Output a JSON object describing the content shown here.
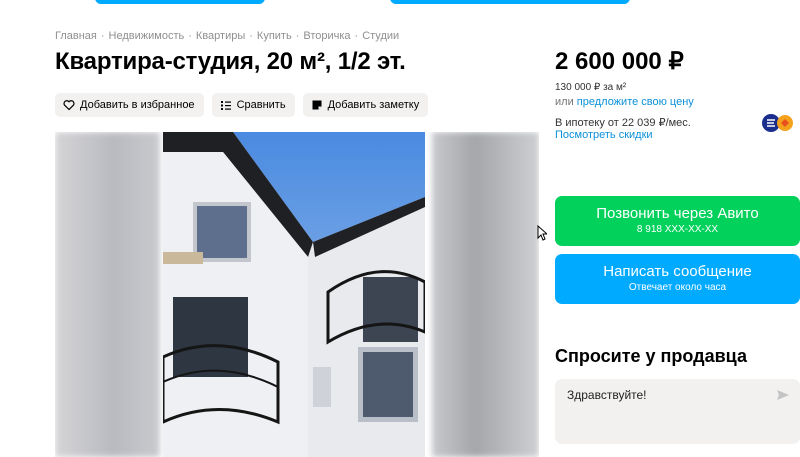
{
  "breadcrumb": [
    "Главная",
    "Недвижимость",
    "Квартиры",
    "Купить",
    "Вторичка",
    "Студии"
  ],
  "listing": {
    "title": "Квартира-студия, 20 м², 1/2 эт."
  },
  "actions": {
    "favorite": "Добавить в избранное",
    "compare": "Сравнить",
    "note": "Добавить заметку"
  },
  "price": {
    "value": "2 600 000 ₽",
    "per_m2": "130 000 ₽ за м²",
    "offer_prefix": "или",
    "offer_link": "предложите свою цену",
    "mortgage": "В ипотеку от 22 039 ₽/мес.",
    "discounts": "Посмотреть скидки"
  },
  "contact": {
    "call_label": "Позвонить через Авито",
    "phone": "8 918 XXX-XX-XX",
    "message_label": "Написать сообщение",
    "response_time": "Отвечает около часа"
  },
  "ask_seller": {
    "title": "Спросите у продавца",
    "input_value": "Здравствуйте!"
  },
  "colors": {
    "call_button": "#02d15c",
    "message_button": "#00aaff",
    "link": "#0a8fd8"
  },
  "icons": [
    "heart-icon",
    "compare-icon",
    "note-icon",
    "send-icon",
    "bank-logo-icon"
  ]
}
